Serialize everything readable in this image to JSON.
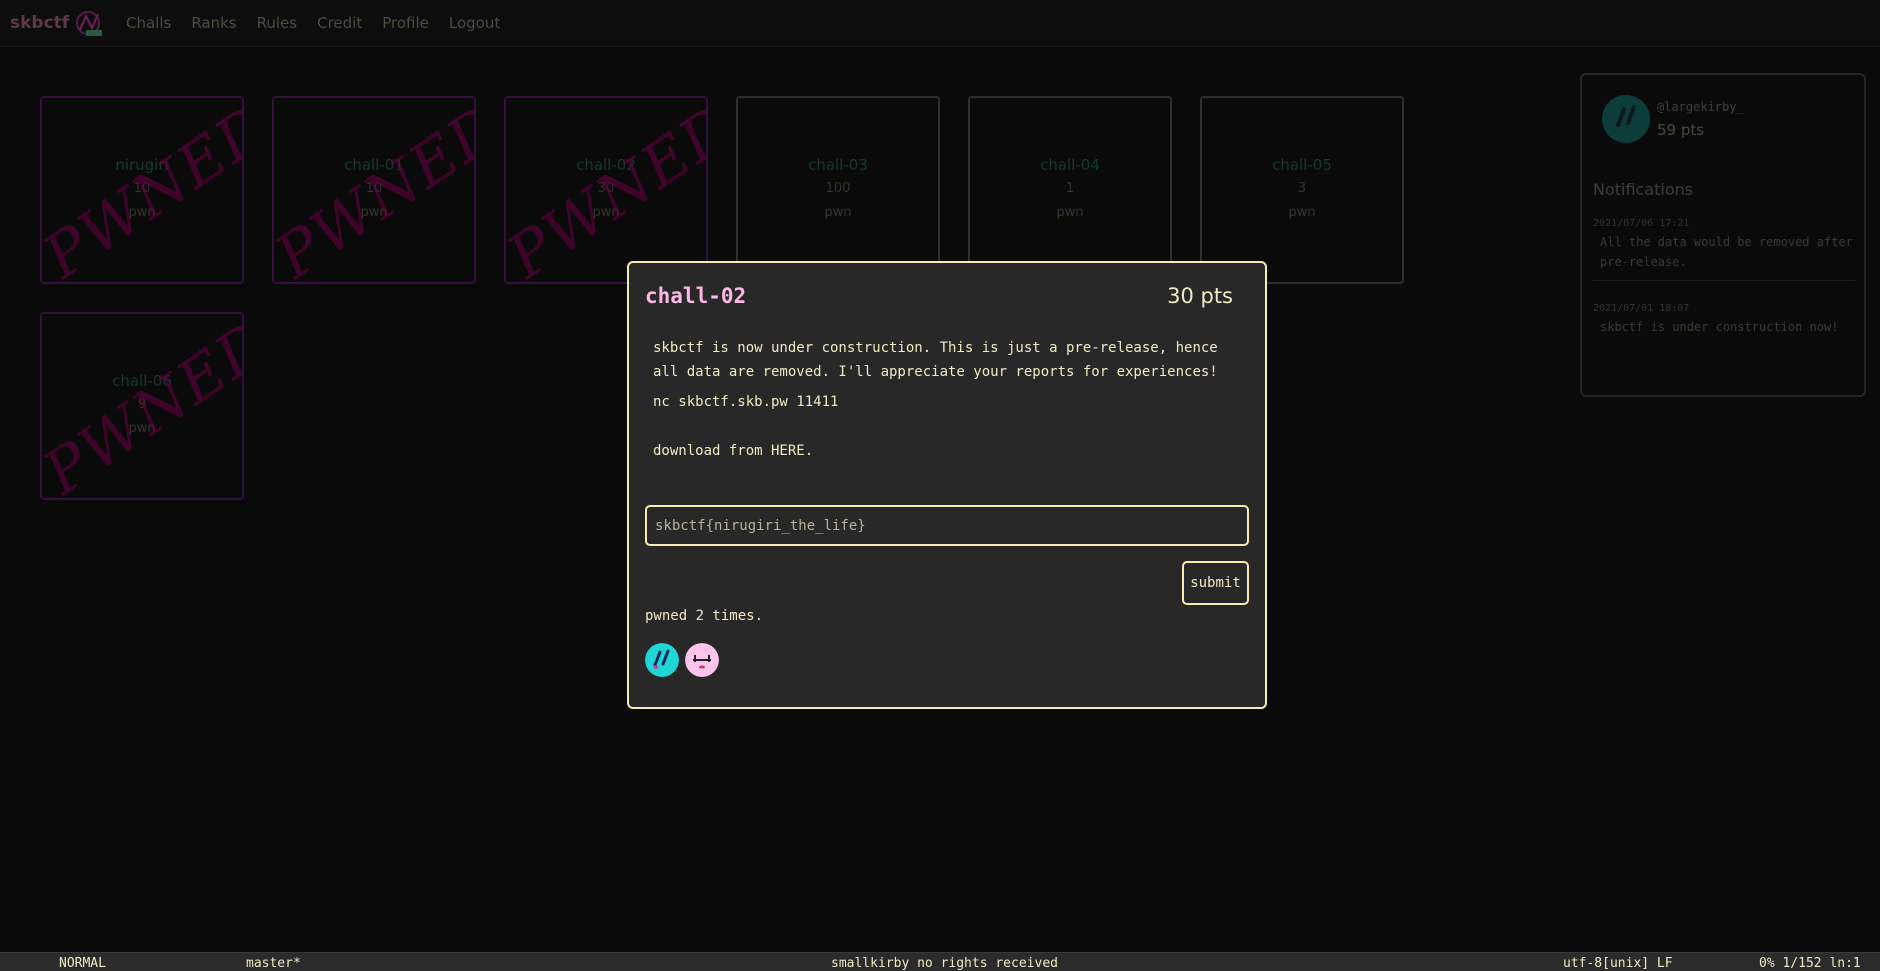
{
  "navbar": {
    "brand": "skbctf",
    "items": [
      {
        "label": "Challs"
      },
      {
        "label": "Ranks"
      },
      {
        "label": "Rules"
      },
      {
        "label": "Credit"
      },
      {
        "label": "Profile"
      },
      {
        "label": "Logout"
      }
    ]
  },
  "challenges": [
    {
      "name": "nirugiri",
      "points": "10",
      "genre": "pwn",
      "pwned": true,
      "stamp": "PWNED"
    },
    {
      "name": "chall-01",
      "points": "10",
      "genre": "pwn",
      "pwned": true,
      "stamp": "PWNED"
    },
    {
      "name": "chall-02",
      "points": "30",
      "genre": "pwn",
      "pwned": true,
      "stamp": "PWNED"
    },
    {
      "name": "chall-03",
      "points": "100",
      "genre": "pwn",
      "pwned": false
    },
    {
      "name": "chall-04",
      "points": "1",
      "genre": "pwn",
      "pwned": false
    },
    {
      "name": "chall-05",
      "points": "3",
      "genre": "pwn",
      "pwned": false
    },
    {
      "name": "chall-06",
      "points": "9",
      "genre": "pwn",
      "pwned": true,
      "stamp": "PWNED"
    }
  ],
  "profile": {
    "username": "@largekirby_",
    "points": "59 pts"
  },
  "notifications": {
    "title": "Notifications",
    "items": [
      {
        "date": "2021/07/06 17:21",
        "text": "All the data would be removed after pre-release."
      },
      {
        "date": "2021/07/01 18:07",
        "text": "skbctf is under construction now!"
      }
    ]
  },
  "modal": {
    "title": "chall-02",
    "points": "30 pts",
    "description": "skbctf is now under construction. This is just a pre-release, hence all data are removed. I'll appreciate your reports for experiences!",
    "nc": "nc skbctf.skb.pw 11411",
    "download": "download from HERE.",
    "flag_placeholder": "skbctf{nirugiri_the_life}",
    "submit_label": "submit",
    "pwned_count": "pwned 2 times."
  },
  "statusline": {
    "mode": "NORMAL",
    "branch": "master*",
    "message": "smallkirby no rights received",
    "encoding": "utf-8[unix] LF",
    "position": "0% 1/152 ln:1"
  },
  "colors": {
    "accent": "#f7ebb2",
    "title_pink": "#ffb8e6",
    "pwned_purple": "#35103e",
    "stamp": "#6e0046",
    "avatar_cyan": "#1fd6d6",
    "avatar_pink": "#ffc4ec"
  }
}
